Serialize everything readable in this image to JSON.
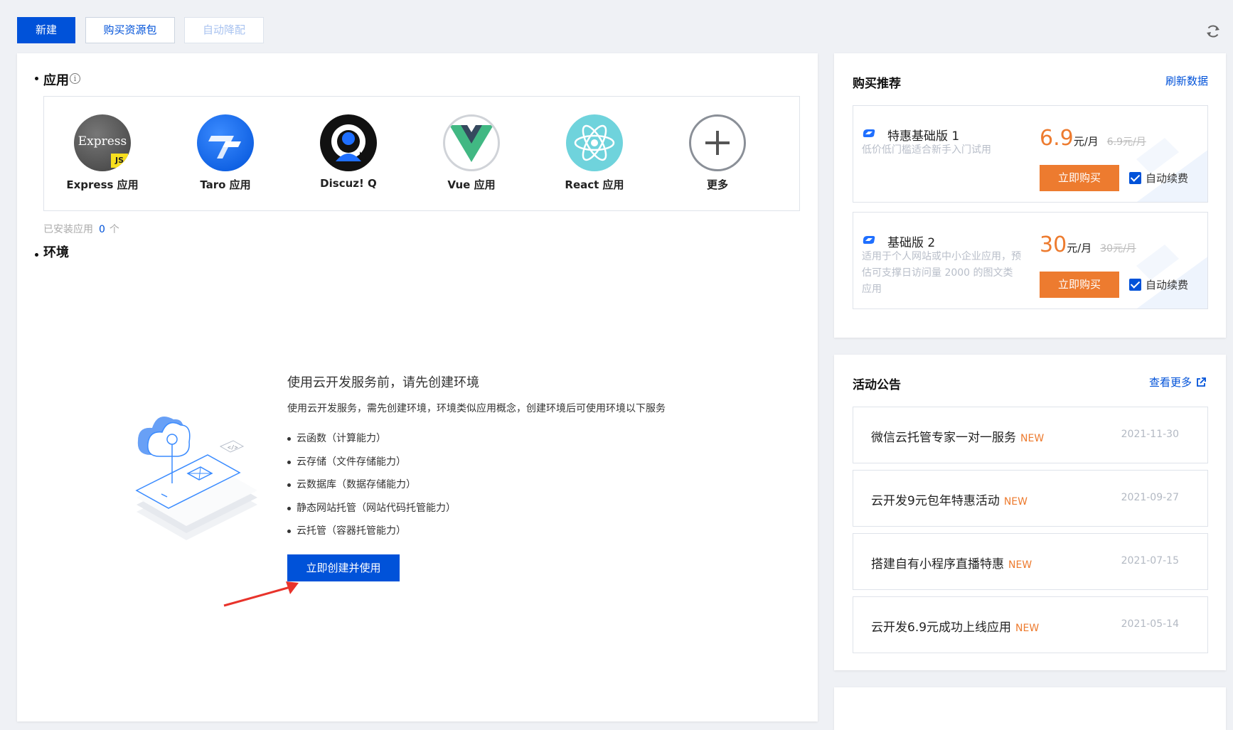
{
  "toolbar": {
    "new_label": "新建",
    "buy_pack_label": "购买资源包",
    "auto_downgrade_label": "自动降配"
  },
  "apps_section": {
    "title": "应用",
    "apps": [
      {
        "label": "Express 应用",
        "icon": "express-icon"
      },
      {
        "label": "Taro 应用",
        "icon": "taro-icon"
      },
      {
        "label": "Discuz! Q",
        "icon": "discuz-icon"
      },
      {
        "label": "Vue 应用",
        "icon": "vue-icon"
      },
      {
        "label": "React 应用",
        "icon": "react-icon"
      },
      {
        "label": "更多",
        "icon": "plus-icon"
      }
    ],
    "express_icon_text": "Express",
    "express_js_badge": "JS",
    "installed_prefix": "已安装应用",
    "installed_count": "0",
    "installed_suffix": "个"
  },
  "env_section": {
    "title": "环境",
    "intro_title": "使用云开发服务前，请先创建环境",
    "intro_desc": "使用云开发服务，需先创建环境，环境类似应用概念，创建环境后可使用环境以下服务",
    "services": [
      "云函数（计算能力）",
      "云存储（文件存储能力）",
      "云数据库（数据存储能力）",
      "静态网站托管（网站代码托管能力）",
      "云托管（容器托管能力）"
    ],
    "create_button": "立即创建并使用"
  },
  "purchase": {
    "title": "购买推荐",
    "refresh_link": "刷新数据",
    "plans": [
      {
        "name": "特惠基础版 1",
        "desc": "低价低门槛适合新手入门试用",
        "price": "6.9",
        "unit": "元/月",
        "old_price": "6.9元/月",
        "buy_label": "立即购买",
        "renew_label": "自动续费",
        "auto_renew": true
      },
      {
        "name": "基础版 2",
        "desc": "适用于个人网站或中小企业应用，预估可支撑日访问量 2000 的图文类应用",
        "price": "30",
        "unit": "元/月",
        "old_price": "30元/月",
        "buy_label": "立即购买",
        "renew_label": "自动续费",
        "auto_renew": true
      }
    ]
  },
  "announcements": {
    "title": "活动公告",
    "more_link": "查看更多",
    "items": [
      {
        "title": "微信云托管专家一对一服务",
        "badge": "NEW",
        "date": "2021-11-30"
      },
      {
        "title": "云开发9元包年特惠活动",
        "badge": "NEW",
        "date": "2021-09-27"
      },
      {
        "title": "搭建自有小程序直播特惠",
        "badge": "NEW",
        "date": "2021-07-15"
      },
      {
        "title": "云开发6.9元成功上线应用",
        "badge": "NEW",
        "date": "2021-05-14"
      }
    ]
  },
  "colors": {
    "primary": "#0052d9",
    "accent_orange": "#ed7b2f",
    "background": "#eff1f5"
  }
}
